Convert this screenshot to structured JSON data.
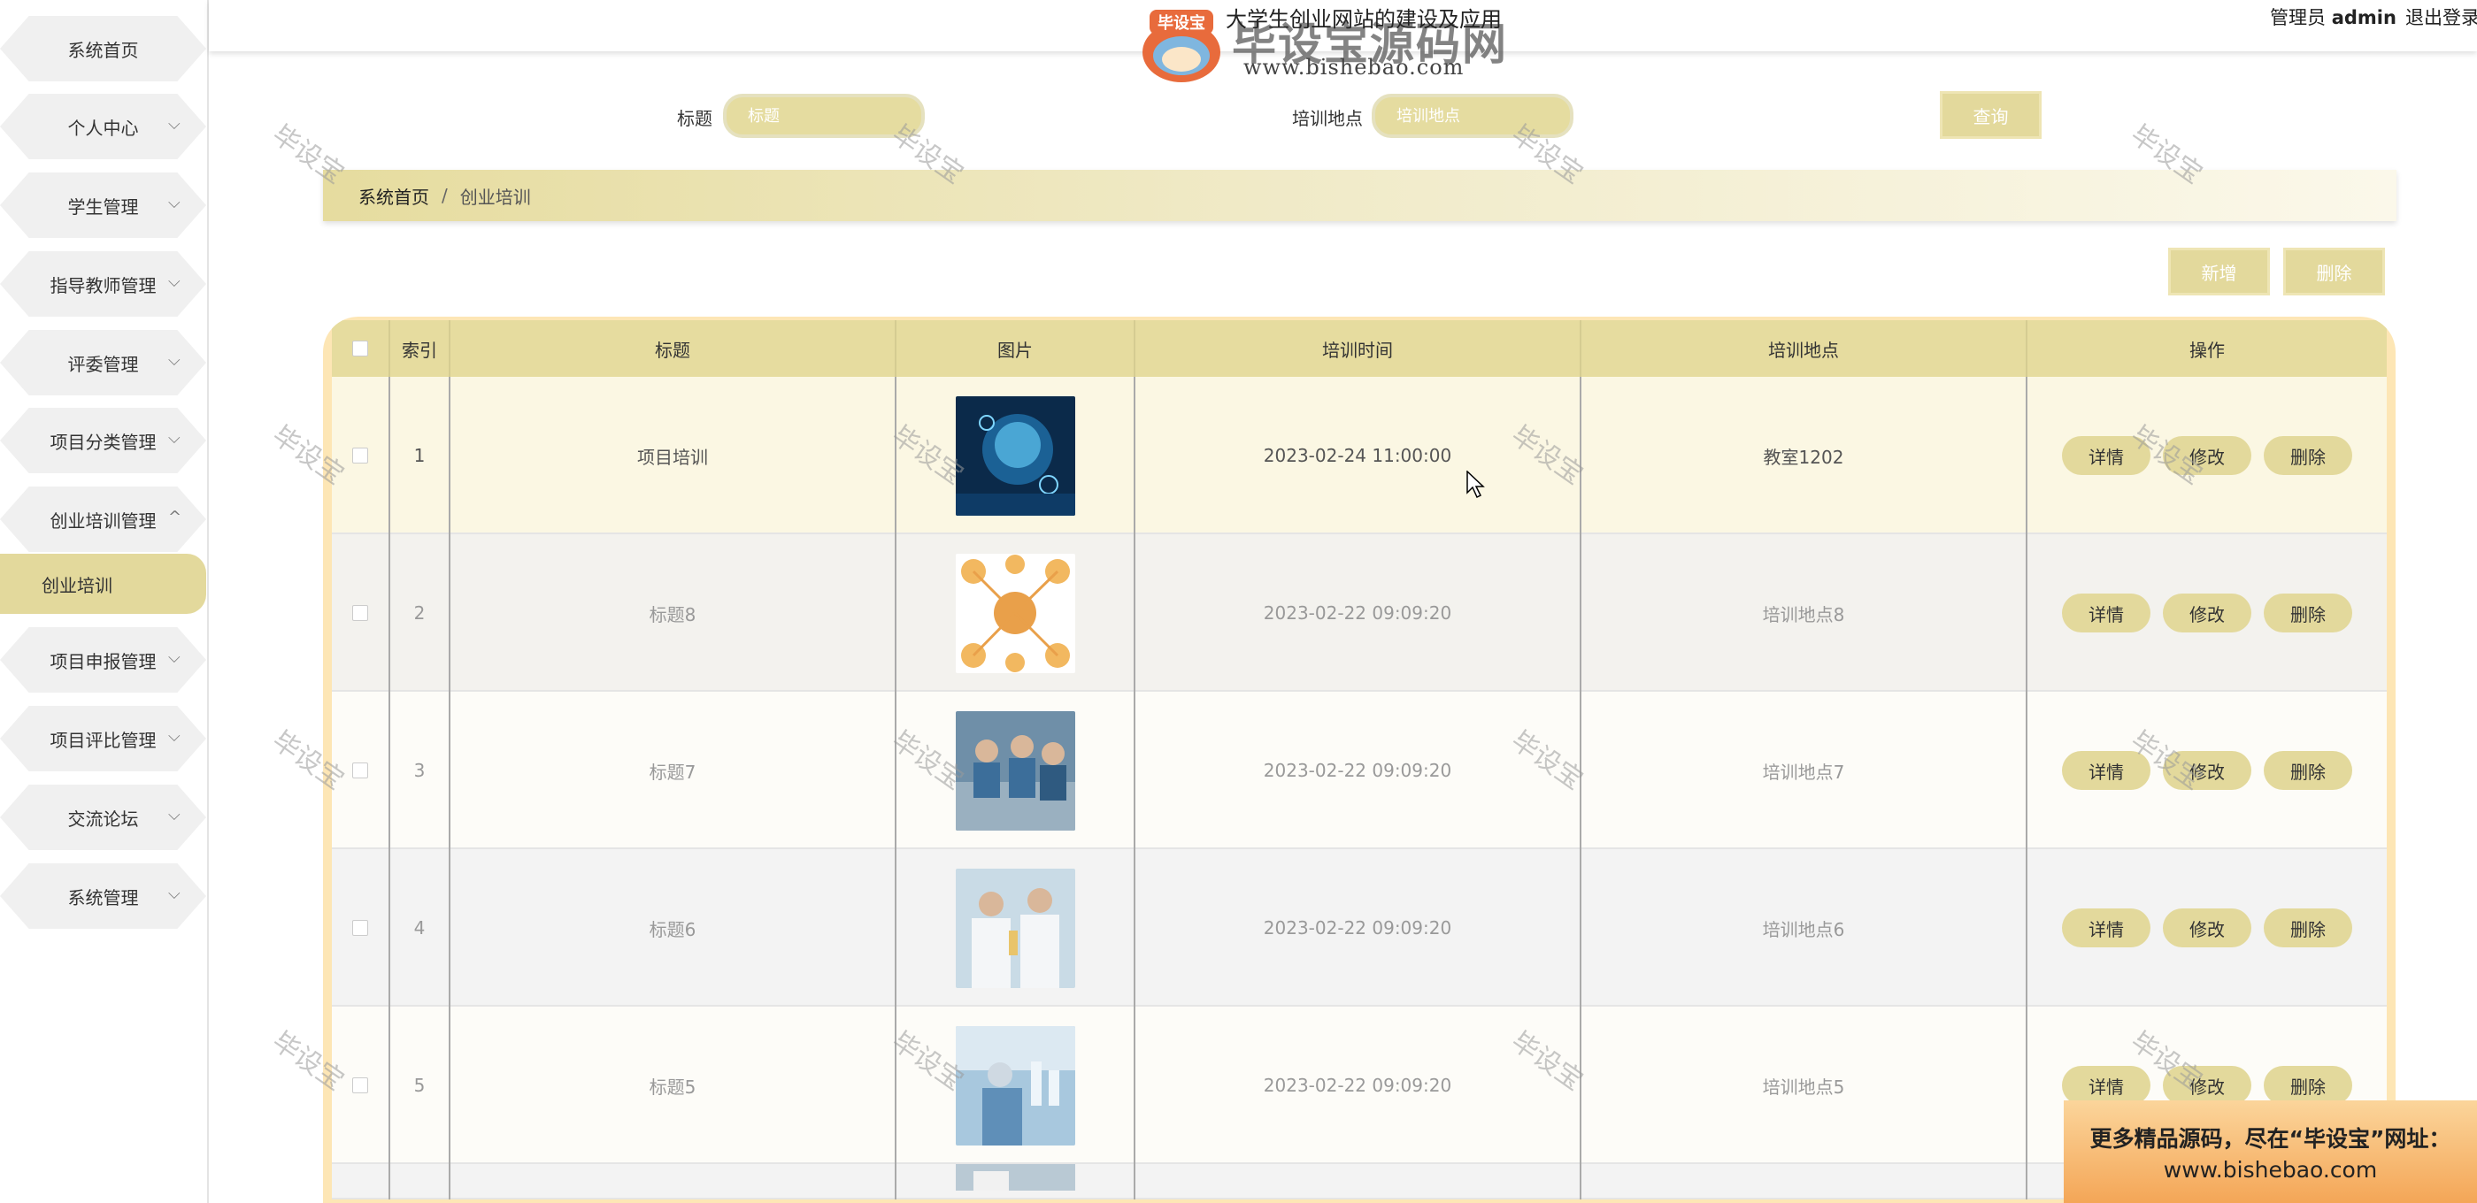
{
  "sidebar": {
    "items": [
      {
        "label": "系统首页"
      },
      {
        "label": "个人中心"
      },
      {
        "label": "学生管理"
      },
      {
        "label": "指导教师管理"
      },
      {
        "label": "评委管理"
      },
      {
        "label": "项目分类管理"
      },
      {
        "label": "创业培训管理"
      },
      {
        "label": "创业培训"
      },
      {
        "label": "项目申报管理"
      },
      {
        "label": "项目评比管理"
      },
      {
        "label": "交流论坛"
      },
      {
        "label": "系统管理"
      }
    ]
  },
  "header": {
    "title": "大学生创业网站的建设及应用",
    "admin_role": "管理员",
    "admin_name": "admin",
    "logout": "退出登录"
  },
  "brand": {
    "logo_text": "毕设宝",
    "name": "毕设宝源码网",
    "url": "www.bishebao.com"
  },
  "search": {
    "title_label": "标题",
    "title_placeholder": "标题",
    "location_label": "培训地点",
    "location_placeholder": "培训地点",
    "query_button": "查询"
  },
  "breadcrumb": {
    "home": "系统首页",
    "separator": "/",
    "current": "创业培训"
  },
  "toolbar": {
    "add_button": "新增",
    "delete_button": "删除"
  },
  "table": {
    "headers": [
      "索引",
      "标题",
      "图片",
      "培训时间",
      "培训地点",
      "操作"
    ],
    "rows": [
      {
        "index": "1",
        "title": "项目培训",
        "image": "ai-head-image",
        "time": "2023-02-24 11:00:00",
        "location": "教室1202"
      },
      {
        "index": "2",
        "title": "标题8",
        "image": "science-icons-image",
        "time": "2023-02-22 09:09:20",
        "location": "培训地点8"
      },
      {
        "index": "3",
        "title": "标题7",
        "image": "lab-team-image",
        "time": "2023-02-22 09:09:20",
        "location": "培训地点7"
      },
      {
        "index": "4",
        "title": "标题6",
        "image": "lab-scientists-image",
        "time": "2023-02-22 09:09:20",
        "location": "培训地点6"
      },
      {
        "index": "5",
        "title": "标题5",
        "image": "lab-blue-image",
        "time": "2023-02-22 09:09:20",
        "location": "培训地点5"
      }
    ],
    "actions": {
      "detail": "详情",
      "edit": "修改",
      "delete": "删除"
    }
  },
  "watermark_text": "毕设宝",
  "banner": {
    "line1": "更多精品源码，尽在“毕设宝”网址：",
    "line2": "www.bishebao.com"
  },
  "colors": {
    "accent": "#e3d99c",
    "table_border": "#fde6b5",
    "banner": "#f4a657"
  }
}
